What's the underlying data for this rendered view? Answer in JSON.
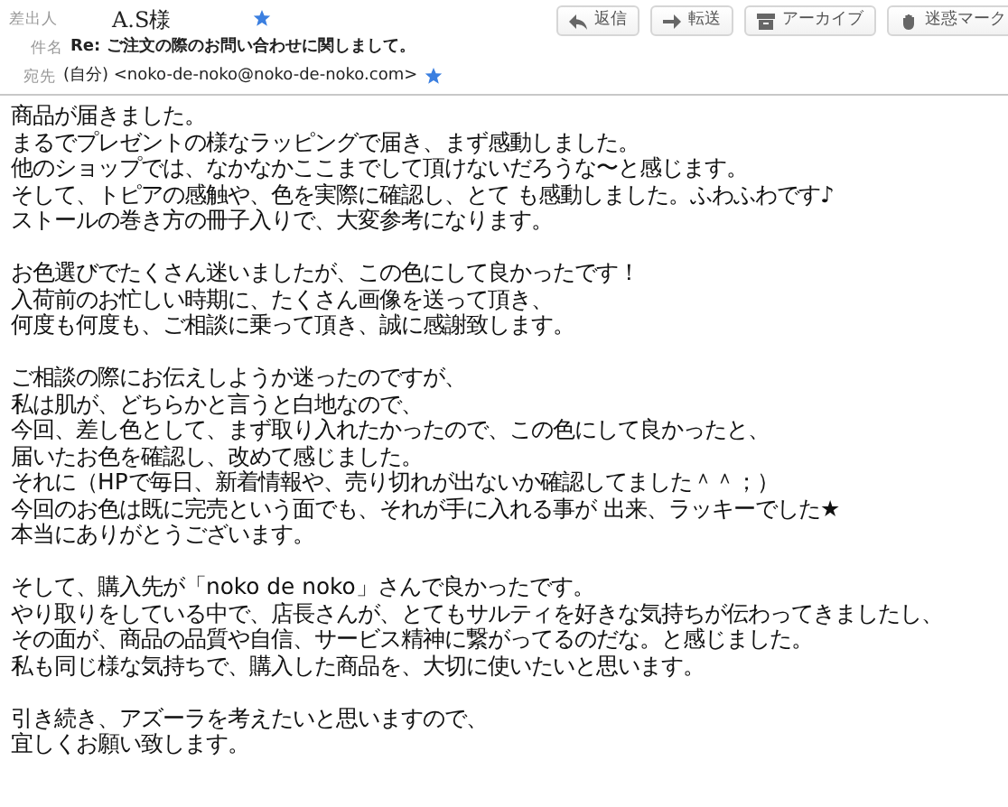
{
  "header": {
    "from_label": "差出人",
    "from_name": "A.S様",
    "from_starred": true,
    "subject_label": "件名",
    "subject": "Re: ご注文の際のお問い合わせに関しまして。",
    "to_label": "宛先",
    "to": "(自分) <noko-de-noko@noko-de-noko.com>",
    "to_starred": true,
    "buttons": [
      {
        "kind": "reply",
        "label": "返信"
      },
      {
        "kind": "forward",
        "label": "転送"
      },
      {
        "kind": "archive",
        "label": "アーカイブ"
      },
      {
        "kind": "spam",
        "label": "迷惑マーク"
      }
    ]
  },
  "body": [
    [
      "商品が届きました。",
      "まるでプレゼントの様なラッピングで届き、まず感動しました。",
      "他のショップでは、なかなかここまでして頂けないだろうな〜と感じます。",
      "そして、トピアの感触や、色を実際に確認し、とて も感動しました。ふわふわです♪",
      "ストールの巻き方の冊子入りで、大変参考になります。"
    ],
    [
      "お色選びでたくさん迷いましたが、この色にして良かったです！",
      "入荷前のお忙しい時期に、たくさん画像を送って頂き、",
      "何度も何度も、ご相談に乗って頂き、誠に感謝致します。"
    ],
    [
      "ご相談の際にお伝えしようか迷ったのですが、",
      "私は肌が、どちらかと言うと白地なので、",
      "今回、差し色として、まず取り入れたかったので、この色にして良かったと、",
      "届いたお色を確認し、改めて感じました。",
      "それに（HPで毎日、新着情報や、売り切れが出ないか確認してました＾＾；）",
      "今回のお色は既に完売という面でも、それが手に入れる事が 出来、ラッキーでした★",
      "本当にありがとうございます。"
    ],
    [
      "そして、購入先が「noko de noko」さんで良かったです。",
      "やり取りをしている中で、店長さんが、とてもサルティを好きな気持ちが伝わってきましたし、",
      "その面が、商品の品質や自信、サービス精神に繋がってるのだな。と感じました。",
      "私も同じ様な気持ちで、購入した商品を、大切に使いたいと思います。"
    ],
    [
      "引き続き、アズーラを考えたいと思いますので、",
      "宜しくお願い致します。"
    ]
  ]
}
